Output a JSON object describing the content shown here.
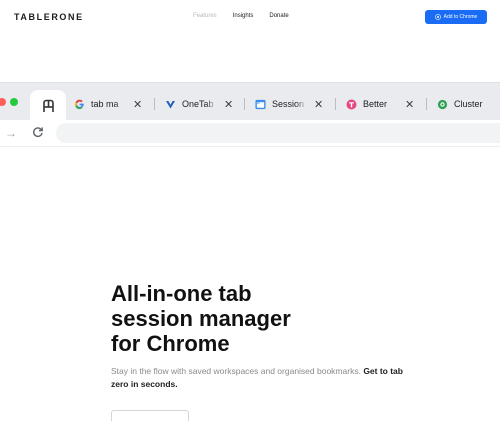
{
  "nav": {
    "logo": "TABLERONE",
    "links": [
      "Features",
      "Insights",
      "Donate"
    ],
    "cta_label": "Add to Chrome"
  },
  "browser": {
    "tabs": [
      {
        "title": "tab ma",
        "icon": "google-icon"
      },
      {
        "title": "OneTab",
        "icon": "onetab-icon"
      },
      {
        "title": "Session",
        "icon": "session-buddy-icon"
      },
      {
        "title": "Better",
        "icon": "better-tab-icon"
      },
      {
        "title": "Cluster",
        "icon": "cluster-icon"
      }
    ],
    "active_tab_icon": "tablerone-icon"
  },
  "hero": {
    "title_lines": [
      "All-in-one tab",
      "session manager",
      "for Chrome"
    ],
    "subtitle": "Stay in the flow with saved workspaces and organised bookmarks.",
    "subtitle_emphasis": "Get to tab zero in seconds."
  },
  "colors": {
    "accent": "#1a6cf5",
    "tabstrip": "#e9ebee",
    "light_red": "#ff5f57",
    "light_green": "#28c840"
  }
}
